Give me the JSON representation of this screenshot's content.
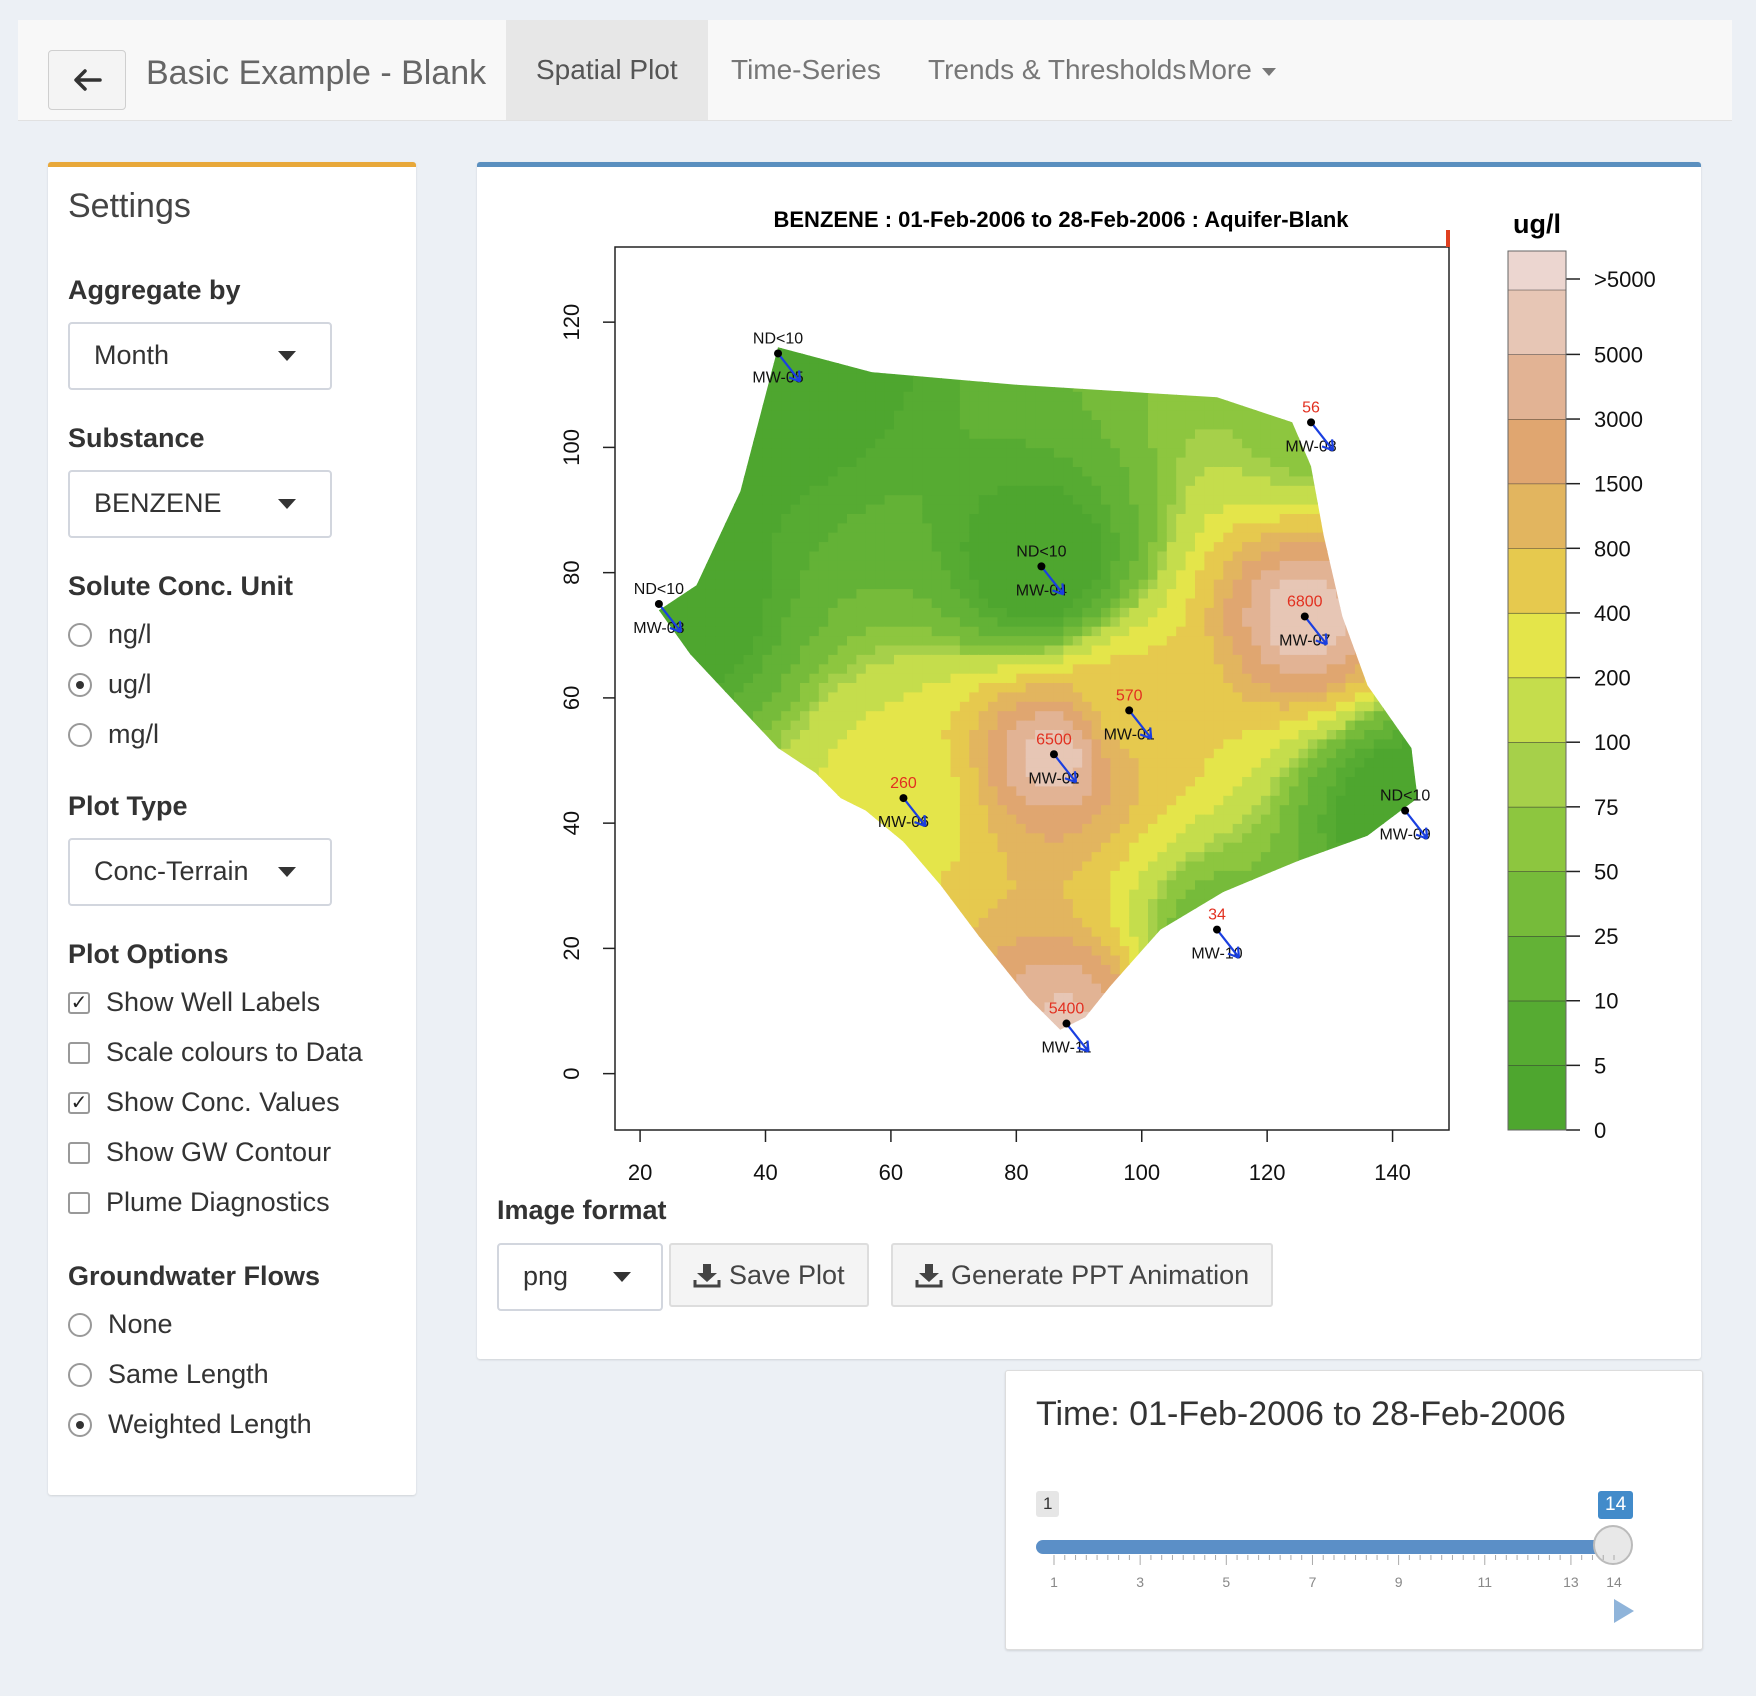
{
  "navbar": {
    "title": "Basic Example - Blank",
    "tabs": [
      {
        "label": "Spatial Plot"
      },
      {
        "label": "Time-Series"
      },
      {
        "label": "Trends & Thresholds"
      },
      {
        "label": "More"
      }
    ]
  },
  "settings": {
    "title": "Settings",
    "aggregate_label": "Aggregate by",
    "aggregate_value": "Month",
    "substance_label": "Substance",
    "substance_value": "BENZENE",
    "unit_label": "Solute Conc. Unit",
    "units": [
      {
        "label": "ng/l",
        "selected": false
      },
      {
        "label": "ug/l",
        "selected": true
      },
      {
        "label": "mg/l",
        "selected": false
      }
    ],
    "plot_type_label": "Plot Type",
    "plot_type_value": "Conc-Terrain",
    "plot_options_label": "Plot Options",
    "plot_options": [
      {
        "label": "Show Well Labels",
        "checked": true
      },
      {
        "label": "Scale colours to Data",
        "checked": false
      },
      {
        "label": "Show Conc. Values",
        "checked": true
      },
      {
        "label": "Show GW Contour",
        "checked": false
      },
      {
        "label": "Plume Diagnostics",
        "checked": false
      }
    ],
    "gw_label": "Groundwater Flows",
    "gw_options": [
      {
        "label": "None",
        "selected": false
      },
      {
        "label": "Same Length",
        "selected": false
      },
      {
        "label": "Weighted Length",
        "selected": true
      }
    ]
  },
  "plot": {
    "image_format_label": "Image format",
    "image_format_value": "png",
    "save_button": "Save Plot",
    "ppt_button": "Generate PPT Animation"
  },
  "chart_data": {
    "type": "heatmap",
    "title": "BENZENE  : 01-Feb-2006 to 28-Feb-2006 : Aquifer-Blank",
    "xlim": [
      16,
      149
    ],
    "ylim": [
      -9,
      132
    ],
    "x_ticks": [
      20,
      40,
      60,
      80,
      100,
      120,
      140
    ],
    "y_ticks": [
      0,
      20,
      40,
      60,
      80,
      100,
      120
    ],
    "legend_title": "ug/l",
    "legend_levels": [
      "0",
      "5",
      "10",
      "25",
      "50",
      "75",
      "100",
      "200",
      "400",
      "800",
      "1500",
      "3000",
      "5000",
      ">5000"
    ],
    "legend_colors": [
      "#4ea62f",
      "#56ab32",
      "#63b236",
      "#76bb3a",
      "#8dc63f",
      "#a6d04a",
      "#c5dd4c",
      "#e4e54a",
      "#e6c94e",
      "#e2b55f",
      "#e0a670",
      "#e2b394",
      "#e7c6b5",
      "#ecd6d0"
    ],
    "legend_position": "right",
    "domain_boundary": [
      [
        42,
        116
      ],
      [
        36,
        93
      ],
      [
        29,
        78
      ],
      [
        23,
        74
      ],
      [
        28,
        67
      ],
      [
        42,
        52
      ],
      [
        48,
        48
      ],
      [
        52,
        44
      ],
      [
        56,
        42
      ],
      [
        62,
        37
      ],
      [
        68,
        30
      ],
      [
        74,
        22
      ],
      [
        82,
        12
      ],
      [
        87,
        7
      ],
      [
        91,
        9
      ],
      [
        95,
        14
      ],
      [
        103,
        23
      ],
      [
        113,
        29
      ],
      [
        125,
        34
      ],
      [
        136,
        38
      ],
      [
        144,
        44
      ],
      [
        143,
        52
      ],
      [
        136,
        62
      ],
      [
        132,
        73
      ],
      [
        129,
        86
      ],
      [
        127,
        97
      ],
      [
        124,
        104
      ],
      [
        112,
        108
      ],
      [
        80,
        110
      ],
      [
        57,
        112
      ],
      [
        42,
        116
      ]
    ],
    "wells": [
      {
        "name": "MW-01",
        "x": 98,
        "y": 58,
        "conc": "570"
      },
      {
        "name": "MW-02",
        "x": 86,
        "y": 51,
        "conc": "6500"
      },
      {
        "name": "MW-03",
        "x": 23,
        "y": 75,
        "conc": "ND<10"
      },
      {
        "name": "MW-04",
        "x": 84,
        "y": 81,
        "conc": "ND<10"
      },
      {
        "name": "MW-05",
        "x": 42,
        "y": 115,
        "conc": "ND<10"
      },
      {
        "name": "MW-06",
        "x": 62,
        "y": 44,
        "conc": "260"
      },
      {
        "name": "MW-07",
        "x": 126,
        "y": 73,
        "conc": "6800"
      },
      {
        "name": "MW-08",
        "x": 127,
        "y": 104,
        "conc": "56"
      },
      {
        "name": "MW-09",
        "x": 142,
        "y": 42,
        "conc": "ND<10"
      },
      {
        "name": "MW-10",
        "x": 112,
        "y": 23,
        "conc": "34"
      },
      {
        "name": "MW-11",
        "x": 88,
        "y": 8,
        "conc": "5400"
      }
    ]
  },
  "time": {
    "title": "Time: 01-Feb-2006 to 28-Feb-2006",
    "min": "1",
    "max": "14",
    "value": 14,
    "tick_labels": [
      "1",
      "3",
      "5",
      "7",
      "9",
      "11",
      "13",
      "14"
    ]
  }
}
